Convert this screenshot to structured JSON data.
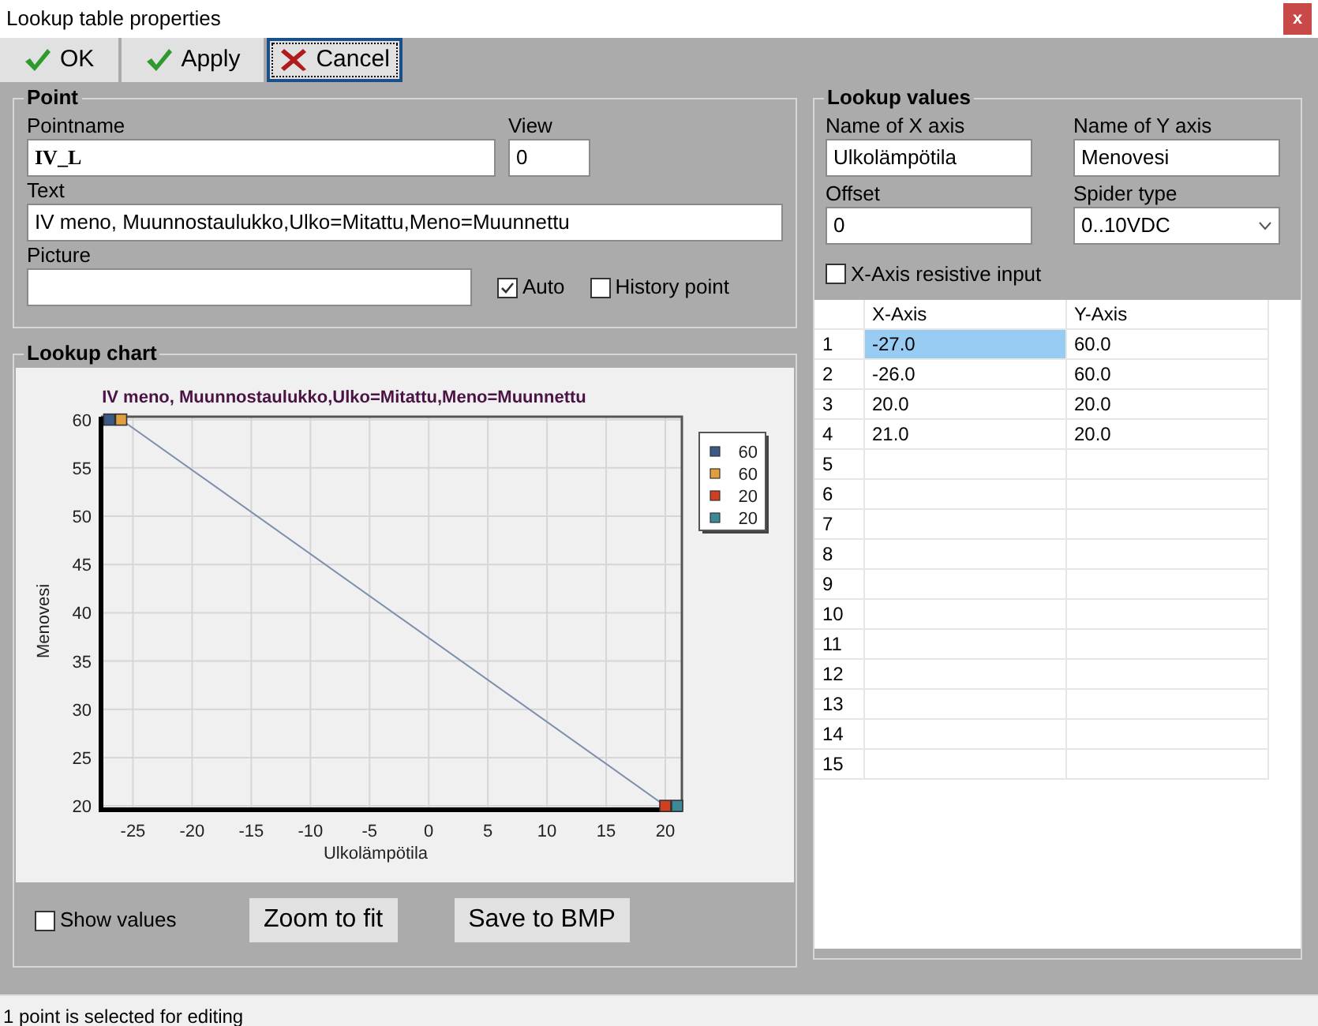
{
  "window": {
    "title": "Lookup table properties",
    "close": "x"
  },
  "toolbar": [
    {
      "label": "OK",
      "kind": "check",
      "focused": false
    },
    {
      "label": "Apply",
      "kind": "check",
      "focused": false
    },
    {
      "label": "Cancel",
      "kind": "cross",
      "focused": true
    }
  ],
  "point": {
    "title": "Point",
    "pointname": {
      "label": "Pointname",
      "value": "IV_L"
    },
    "view": {
      "label": "View",
      "value": "0"
    },
    "text": {
      "label": "Text",
      "value": "IV meno, Muunnostaulukko,Ulko=Mitattu,Meno=Muunnettu"
    },
    "picture": {
      "label": "Picture"
    },
    "auto": {
      "label": "Auto",
      "checked": true
    },
    "history": {
      "label": "History point",
      "checked": false
    }
  },
  "chart": {
    "title": "Lookup chart",
    "chart_data": {
      "type": "line",
      "title": "IV meno, Muunnostaulukko,Ulko=Mitattu,Meno=Muunnettu",
      "xlabel": "Ulkolämpötila",
      "ylabel": "Menovesi",
      "x": [
        -27,
        -26,
        20,
        21
      ],
      "series": [
        {
          "color": "#7f8fb0",
          "marker": "square",
          "values": [
            60,
            60,
            20,
            20
          ]
        }
      ],
      "grid": true,
      "xlim": [
        -27.7,
        21.4
      ],
      "ylim": [
        19.6,
        60.3
      ],
      "xticks": [
        -25,
        -20,
        -15,
        -10,
        -5,
        0,
        5,
        10,
        15,
        20
      ],
      "yticks": [
        20,
        25,
        30,
        35,
        40,
        45,
        50,
        55,
        60
      ]
    },
    "legend": [
      {
        "label": "60",
        "color": "#3d5a86"
      },
      {
        "label": "60",
        "color": "#e0a040"
      },
      {
        "label": "20",
        "color": "#d04020"
      },
      {
        "label": "20",
        "color": "#3c8a98"
      }
    ],
    "show_values": {
      "label": "Show values",
      "checked": false
    },
    "buttons": [
      "Zoom to fit",
      "Save to BMP"
    ]
  },
  "lookup": {
    "title": "Lookup values",
    "x_name": {
      "label": "Name of X axis",
      "value": "Ulkolämpötila"
    },
    "y_name": {
      "label": "Name of Y axis",
      "value": "Menovesi"
    },
    "offset": {
      "label": "Offset",
      "value": "0"
    },
    "spider_type": {
      "label": "Spider type",
      "value": "0..10VDC"
    },
    "resistive": {
      "label": "X-Axis resistive input",
      "checked": false
    },
    "table": {
      "columns": [
        "X-Axis",
        "Y-Axis"
      ],
      "rows": [
        {
          "index": "1",
          "cells": [
            {
              "text": "-27.0",
              "selected": true
            },
            {
              "text": "60.0",
              "selected": false
            }
          ]
        },
        {
          "index": "2",
          "cells": [
            {
              "text": "-26.0",
              "selected": false
            },
            {
              "text": "60.0",
              "selected": false
            }
          ]
        },
        {
          "index": "3",
          "cells": [
            {
              "text": "20.0",
              "selected": false
            },
            {
              "text": "20.0",
              "selected": false
            }
          ]
        },
        {
          "index": "4",
          "cells": [
            {
              "text": "21.0",
              "selected": false
            },
            {
              "text": "20.0",
              "selected": false
            }
          ]
        },
        {
          "index": "5"
        },
        {
          "index": "6"
        },
        {
          "index": "7"
        },
        {
          "index": "8"
        },
        {
          "index": "9"
        },
        {
          "index": "10"
        },
        {
          "index": "11"
        },
        {
          "index": "12"
        },
        {
          "index": "13"
        },
        {
          "index": "14"
        },
        {
          "index": "15"
        }
      ]
    }
  },
  "status_bar": "1 point is selected for editing"
}
